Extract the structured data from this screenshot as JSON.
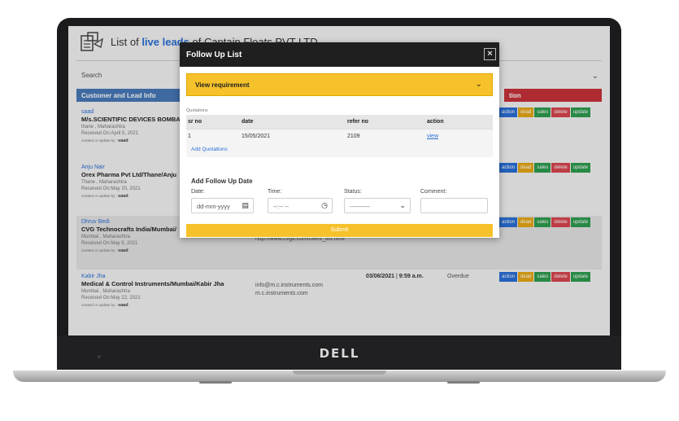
{
  "device": {
    "brand": "DELL"
  },
  "app": {
    "title_prefix": "List of",
    "title_highlight": "live leads",
    "title_suffix": "of Captain Floats PVT LTD",
    "search_label": "Search",
    "col_left": "Customer and Lead Info",
    "col_right": "tion"
  },
  "actions": {
    "action": "action",
    "dead": "dead",
    "sales": "sales",
    "delete": "delete",
    "update": "update"
  },
  "leads": [
    {
      "name": "saad",
      "company": "M/s.SCIENTIFIC DEVICES BOMBAY",
      "location": "thane , Maharashtra",
      "received": "Received On:April 5, 2021",
      "updated_prefix": "created or update by :",
      "updated_by": "saad",
      "contact1": "",
      "contact2": "",
      "date": "",
      "time": "",
      "status": ""
    },
    {
      "name": "Anju Nair",
      "company": "Orex Pharma Pvt Ltd/Thane/Anju",
      "location": "Thane , Maharashtra",
      "received": "Received On:May 20, 2021",
      "updated_prefix": "created or update by :",
      "updated_by": "saad",
      "contact1": "",
      "contact2": "",
      "date": "",
      "time": "",
      "status": ""
    },
    {
      "name": "Dhruv Bedi",
      "company": "CVG Technocrafts India/Mumbai/",
      "location": "Mumbai , Maharashtra",
      "received": "Received On:May 5, 2021",
      "updated_prefix": "created or update by :",
      "updated_by": "saad",
      "contact1": "http://www.cvgti.com/client_list.html",
      "contact2": "",
      "date": "",
      "time": "",
      "status": ""
    },
    {
      "name": "Kabir Jha",
      "company": "Medical & Control Instruments/Mumbai/Kabir Jha",
      "location": "Mumbai , Maharashtra",
      "received": "Received On:May 22, 2021",
      "updated_prefix": "created or update by :",
      "updated_by": "saad",
      "contact1": "info@m.c.instruments.com",
      "contact2": "m.c.instruments.com",
      "date": "03/06/2021",
      "time": "9:59 a.m.",
      "status": "Overdue"
    }
  ],
  "modal": {
    "title": "Follow Up List",
    "close": "×",
    "requirement_label": "View requirement",
    "quotations_label": "Quotations",
    "columns": [
      "sr no",
      "date",
      "refer no",
      "action"
    ],
    "rows": [
      {
        "sr_no": "1",
        "date": "15/05/2021",
        "refer_no": "2109",
        "action": "view"
      }
    ],
    "add_quotations": "Add Quotations",
    "follow_up_title": "Add Follow Up Date",
    "date_label": "Date:",
    "date_placeholder": "dd-mm-yyyy",
    "time_label": "Time:",
    "time_placeholder": "--:-- --",
    "status_label": "Status:",
    "status_value": "----------",
    "comment_label": "Comment:",
    "comment_value": "",
    "submit": "Submit"
  }
}
